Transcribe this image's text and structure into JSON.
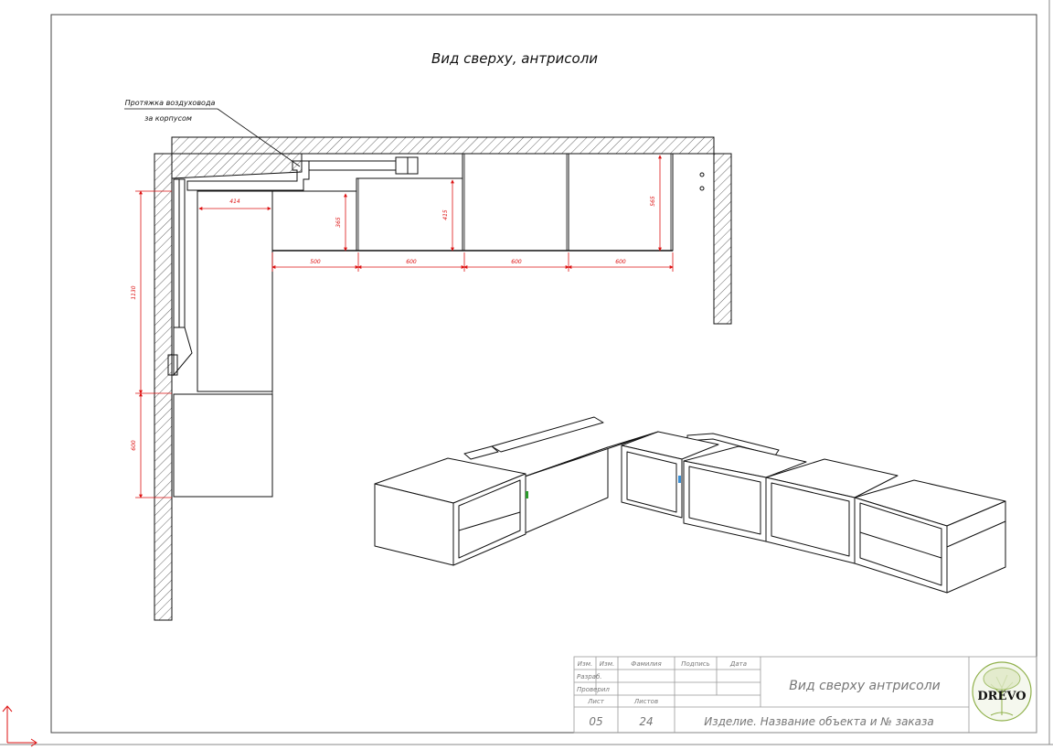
{
  "drawing": {
    "title": "Вид сверху, антрисоли",
    "callout_line1": "Протяжка воздуховода",
    "callout_line2": "за корпусом"
  },
  "dimensions": {
    "top_width_1": "414",
    "top_width_2": "500",
    "top_width_3": "600",
    "top_width_4": "600",
    "top_width_5": "600",
    "depth_1": "365",
    "depth_2": "415",
    "depth_3": "565",
    "side_length_1": "1130",
    "side_length_2": "600"
  },
  "title_block": {
    "hdr_izm": "Изм.",
    "hdr_izm2": "Изм.",
    "hdr_surname": "Фамилия",
    "hdr_signature": "Подпись",
    "hdr_date": "Дата",
    "row_developed": "Разраб.",
    "row_checked": "Проверил",
    "hdr_sheet": "Лист",
    "hdr_sheets": "Листов",
    "sheet_no": "05",
    "sheets_total": "24",
    "document_title": "Вид сверху антрисоли",
    "product_line": "Изделие. Название объекта и № заказа",
    "logo_text": "DREVO"
  },
  "colors": {
    "line": "#111111",
    "dimension": "#dd1111",
    "stamp_text": "#777777",
    "logo_green": "#8fb04a"
  }
}
